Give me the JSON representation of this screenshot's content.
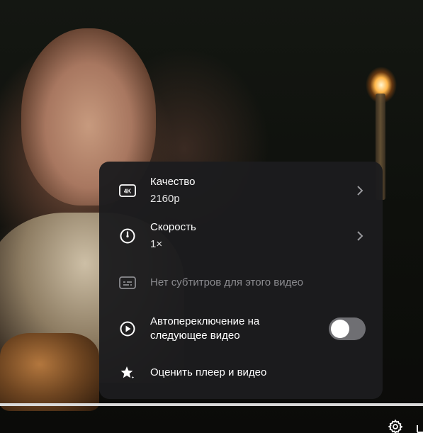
{
  "menu": {
    "quality": {
      "label": "Качество",
      "value": "2160p",
      "icon": "4k-icon"
    },
    "speed": {
      "label": "Скорость",
      "value": "1×",
      "icon": "speed-gauge-icon"
    },
    "subtitles": {
      "label": "Нет субтитров для этого видео",
      "icon": "subtitles-icon"
    },
    "autoplay": {
      "label_line1": "Автопереключение на",
      "label_line2": "следующее видео",
      "icon": "play-circle-icon",
      "enabled": false
    },
    "rate": {
      "label": "Оценить плеер и видео",
      "icon": "star-sparkle-icon"
    }
  },
  "player": {
    "progress": 1.0,
    "settings_icon": "gear-icon"
  },
  "colors": {
    "menu_bg": "#1c1c1e",
    "toggle_off": "#6f6f73",
    "disabled_text": "#8b8b8f"
  }
}
